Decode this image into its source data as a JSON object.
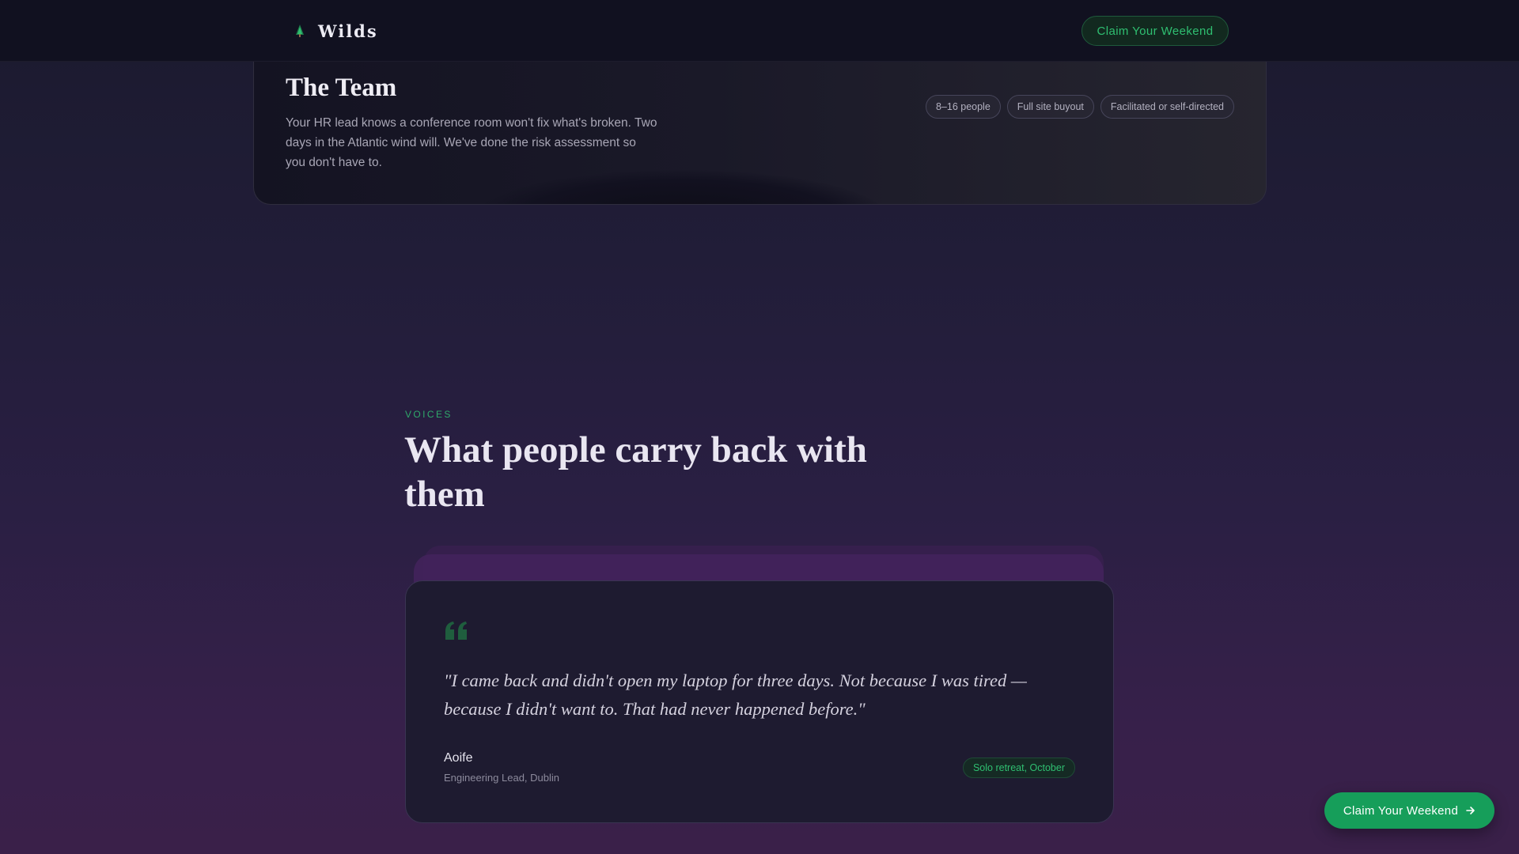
{
  "header": {
    "brand_name": "Wilds",
    "brand_icon": "tree-icon",
    "cta_label": "Claim Your Weekend"
  },
  "team": {
    "title": "The Team",
    "description": "Your HR lead knows a conference room won't fix what's broken. Two days in the Atlantic wind will. We've done the risk assessment so you don't have to.",
    "tags": [
      "8–16 people",
      "Full site buyout",
      "Facilitated or self-directed"
    ]
  },
  "voices": {
    "eyebrow": "VOICES",
    "title": "What people carry back with them",
    "testimonial": {
      "quote": "\"I came back and didn't open my laptop for three days. Not because I was tired — because I didn't want to. That had never happened before.\"",
      "author": "Aoife",
      "role": "Engineering Lead, Dublin",
      "badge": "Solo retreat, October"
    }
  },
  "floating_cta": {
    "label": "Claim Your Weekend",
    "icon": "arrow-right-icon"
  },
  "colors": {
    "accent_green": "#2fbf71",
    "cta_green": "#169e5a",
    "header_bg": "#111120",
    "card_bg": "#1e1b30"
  }
}
